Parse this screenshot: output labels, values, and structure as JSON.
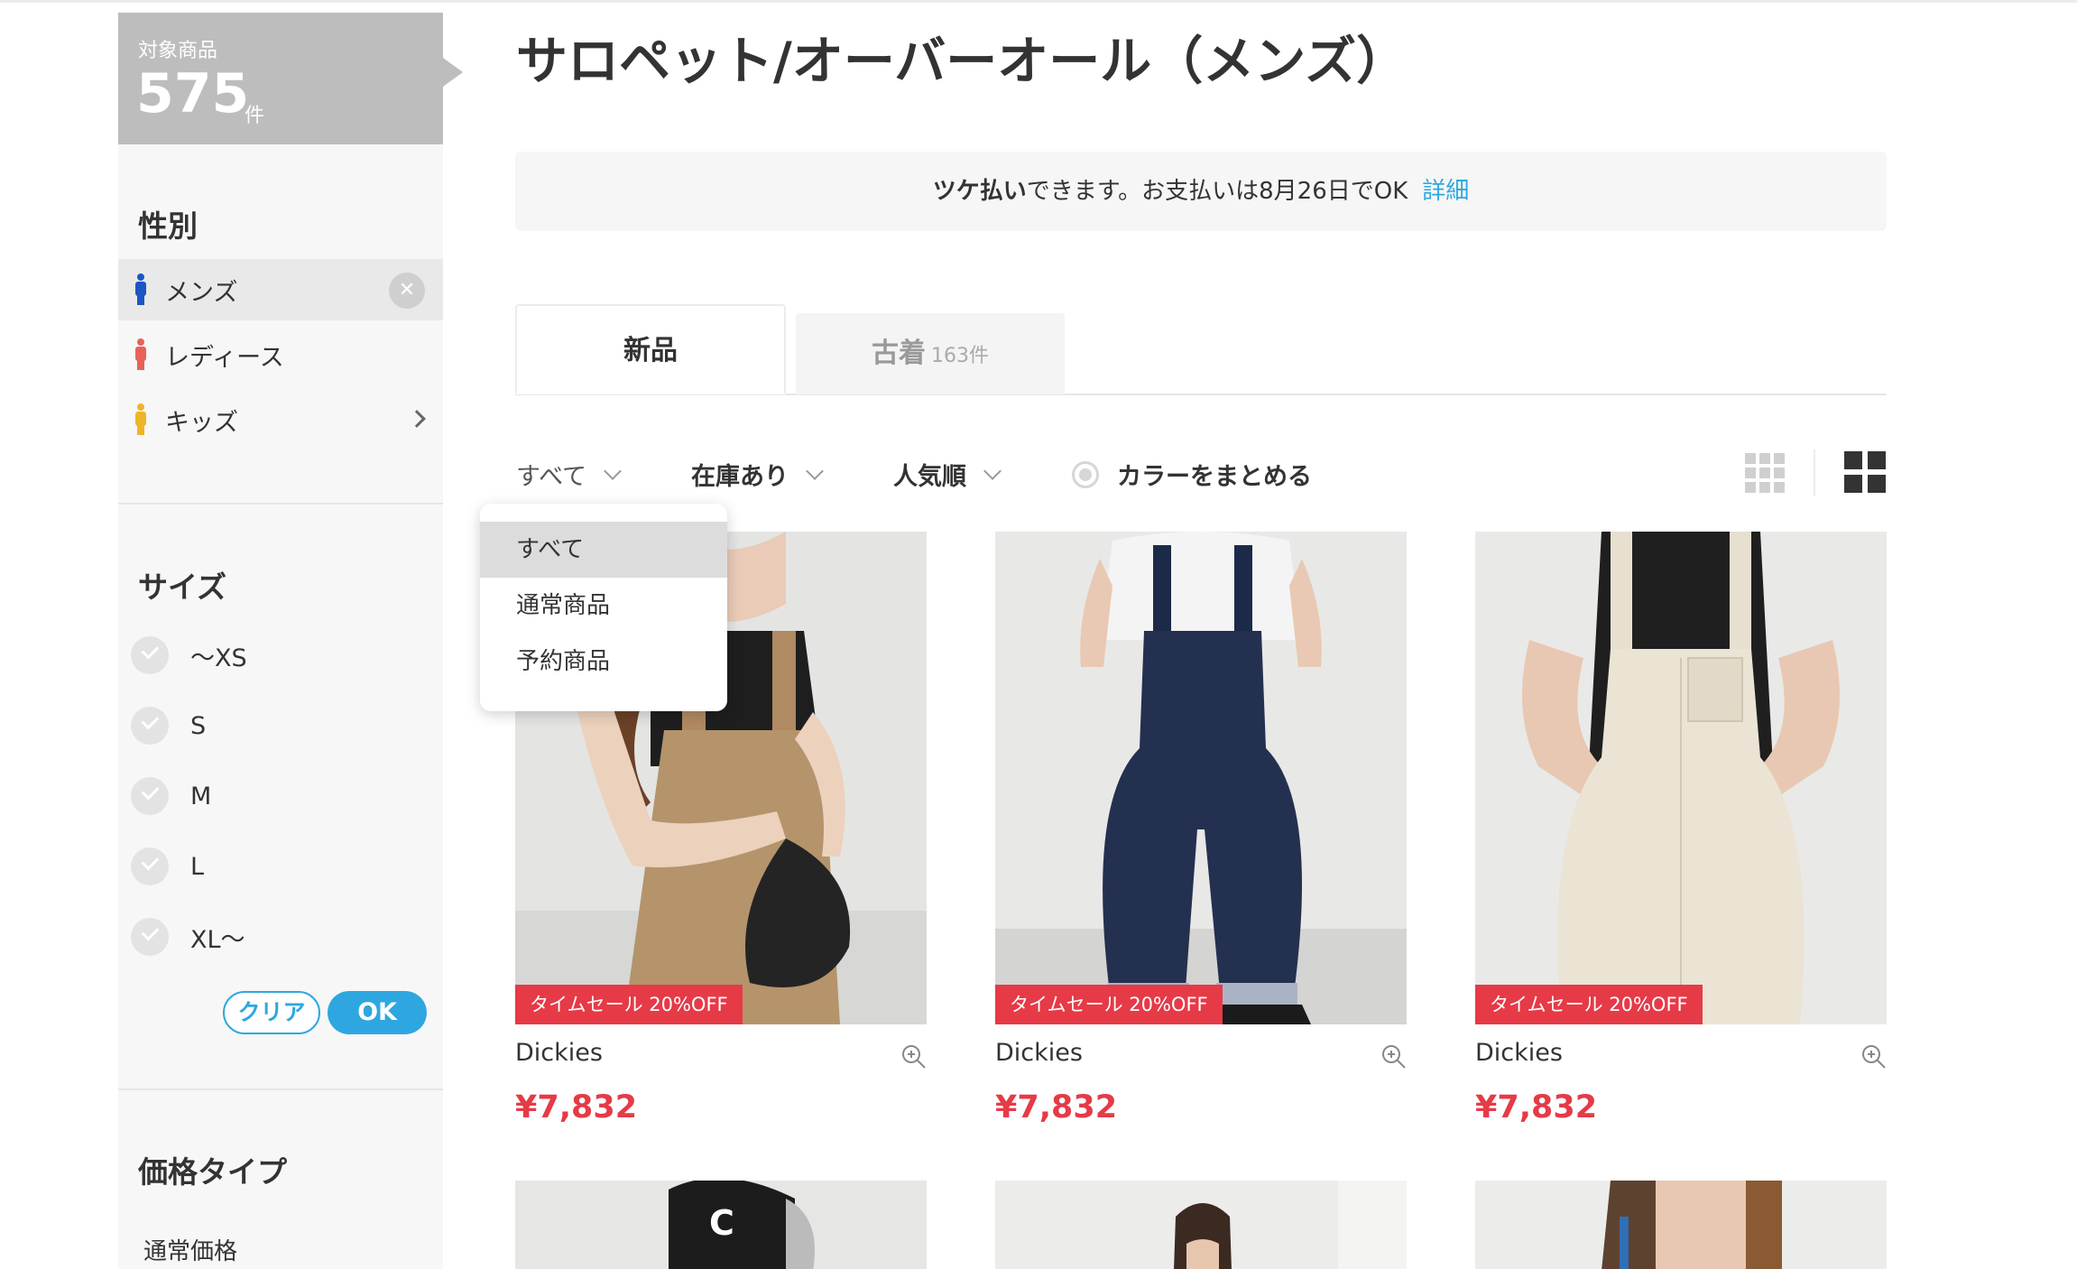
{
  "sidebar": {
    "count_label": "対象商品",
    "count_value": "575",
    "count_unit": "件",
    "gender_title": "性別",
    "genders": [
      {
        "label": "メンズ",
        "color": "#1a56c4"
      },
      {
        "label": "レディース",
        "color": "#e8625a"
      },
      {
        "label": "キッズ",
        "color": "#f0b428"
      }
    ],
    "size_title": "サイズ",
    "sizes": [
      "～XS",
      "S",
      "M",
      "L",
      "XL～"
    ],
    "clear_label": "クリア",
    "ok_label": "OK",
    "price_type_title": "価格タイプ",
    "price_type_item": "通常価格"
  },
  "main": {
    "title": "サロペット/オーバーオール（メンズ）",
    "banner": {
      "bold": "ツケ払い",
      "text": "できます。お支払いは8月26日でOK",
      "link": "詳細"
    },
    "tabs": [
      {
        "label": "新品"
      },
      {
        "label": "古着",
        "count": "163件"
      }
    ],
    "filters": {
      "type": "すべて",
      "stock": "在庫あり",
      "sort": "人気順",
      "color_group": "カラーをまとめる"
    },
    "dropdown": [
      "すべて",
      "通常商品",
      "予約商品"
    ],
    "products": [
      {
        "brand": "Dickies",
        "price": "¥7,832",
        "sale": "タイムセール 20%OFF"
      },
      {
        "brand": "Dickies",
        "price": "¥7,832",
        "sale": "タイムセール 20%OFF"
      },
      {
        "brand": "Dickies",
        "price": "¥7,832",
        "sale": "タイムセール 20%OFF"
      }
    ]
  },
  "colors": {
    "accent": "#2ea7e0",
    "sale_red": "#e63a47"
  }
}
